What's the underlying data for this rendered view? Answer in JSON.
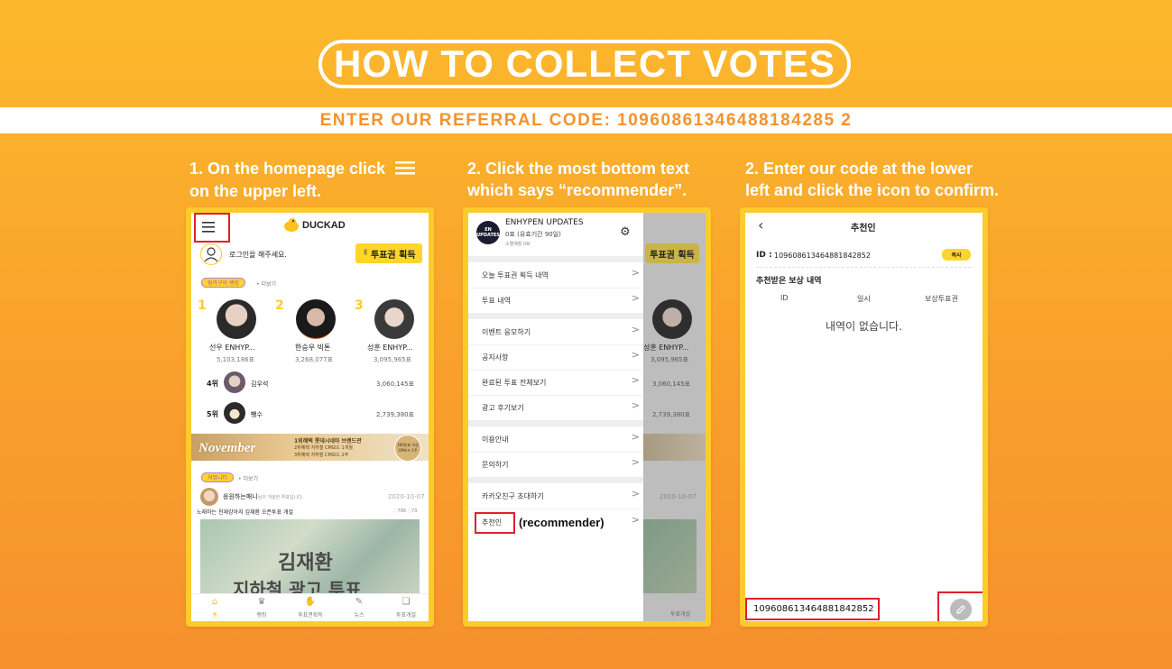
{
  "header": {
    "title": "HOW TO COLLECT VOTES",
    "referral": "ENTER OUR REFERRAL CODE: 10960861346488184285 2"
  },
  "steps": [
    {
      "line1": "1. On the homepage click",
      "line2": "on the upper left."
    },
    {
      "line1": "2. Click the most bottom text",
      "line2": "which says “recommender”."
    },
    {
      "line1": "2. Enter our code at the lower",
      "line2": "left and click the icon to confirm."
    }
  ],
  "phone1": {
    "brand": "DUCKAD",
    "login_prompt": "로그인을 해주세요.",
    "get_ticket": "투표권 획득",
    "ranking_tag": "링카구의 랭킹",
    "more": "• 더보기",
    "top3": [
      {
        "rank": "1",
        "name": "선우 ENHYP...",
        "votes": "5,103,186표"
      },
      {
        "rank": "2",
        "name": "한승우 빅톤",
        "votes": "3,268,077표"
      },
      {
        "rank": "3",
        "name": "성훈 ENHYP...",
        "votes": "3,095,965표"
      }
    ],
    "rows": [
      {
        "rank": "4위",
        "name": "김우석",
        "votes": "3,060,145표"
      },
      {
        "rank": "5위",
        "name": "뺑수",
        "votes": "2,739,380표"
      }
    ],
    "banner_title": "November",
    "banner_line1": "1위혜택 롯데시네마 브랜드관",
    "banner_line2": "2위혜택 지하철 CM보드 1개월",
    "banner_line3": "3위혜택 지하철 CM보드 2주",
    "banner_badge": "300만표 이상 CM보드 1주",
    "community_tag": "커뮤니티",
    "post_author": "응원하는패니",
    "post_suffix": "님이 개설한 투표입니다.",
    "post_date": "2020-10-07",
    "post_title": "노래하는 천재강아지 김재환 오픈투표 개설",
    "post_likes": "♡796",
    "post_comments": "◌73",
    "post_image_text1": "김재환",
    "post_image_text2": "지하철 광고 투표",
    "nav": [
      "홈",
      "랭킹",
      "투표권획득",
      "뉴스",
      "투표개설"
    ]
  },
  "phone2": {
    "channel_name": "ENHYPEN UPDATES",
    "channel_votes": "0표 (유효기간 90일)",
    "channel_sub": "소멸예정 0표",
    "logo_text": "EN UPDATES",
    "menu_groups": [
      [
        "오늘 투표권 획득 내역",
        "투표 내역"
      ],
      [
        "이벤트 응모하기",
        "공지사항",
        "완료된 투표 전체보기",
        "광고 후기보기"
      ],
      [
        "이용안내",
        "문의하기"
      ],
      [
        "카카오친구 초대하기",
        "추천인"
      ]
    ],
    "recommender_note": "(recommender)",
    "bg_name": "성훈 ENHYP...",
    "bg_votes": [
      "3,095,965표",
      "3,060,145표",
      "2,739,380표"
    ],
    "bg_date": "2020-10-07",
    "bg_nav": "투표개설",
    "bg_ticket": "투표권 획득"
  },
  "phone3": {
    "title": "추천인",
    "id_label": "ID :",
    "id_value": "109608613464881842852",
    "copy_label": "복사",
    "section_title": "추천받은 보상 내역",
    "columns": [
      "ID",
      "일시",
      "보상투표권"
    ],
    "empty": "내역이 없습니다.",
    "input_value": "109608613464881842852"
  },
  "colors": {
    "bg_top": "#fcb92c",
    "bg_bottom": "#f6912d",
    "accent_yellow": "#ffd52a",
    "red_highlight": "#e0202a",
    "referral_text": "#f5922d"
  }
}
